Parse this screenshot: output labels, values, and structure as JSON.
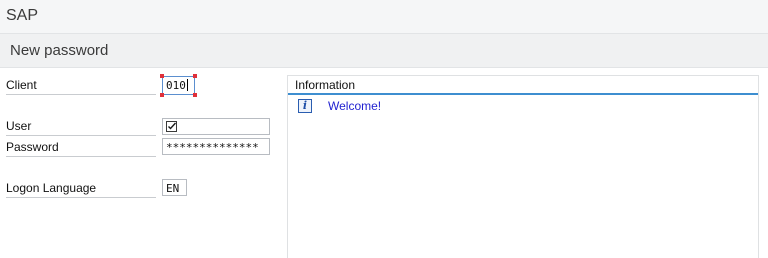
{
  "app": {
    "title": "SAP",
    "screen_title": "New password"
  },
  "form": {
    "client": {
      "label": "Client",
      "value": "010"
    },
    "user": {
      "label": "User",
      "value_icon": "check-box-icon"
    },
    "password": {
      "label": "Password",
      "value": "**************"
    },
    "language": {
      "label": "Logon Language",
      "value": "EN"
    }
  },
  "info": {
    "header": "Information",
    "message_icon": "info-icon",
    "icon_glyph": "i",
    "message": "Welcome!"
  },
  "colors": {
    "accent": "#3d8ed0",
    "message_text": "#1f1fd0",
    "focus_marker": "#e0303a"
  }
}
